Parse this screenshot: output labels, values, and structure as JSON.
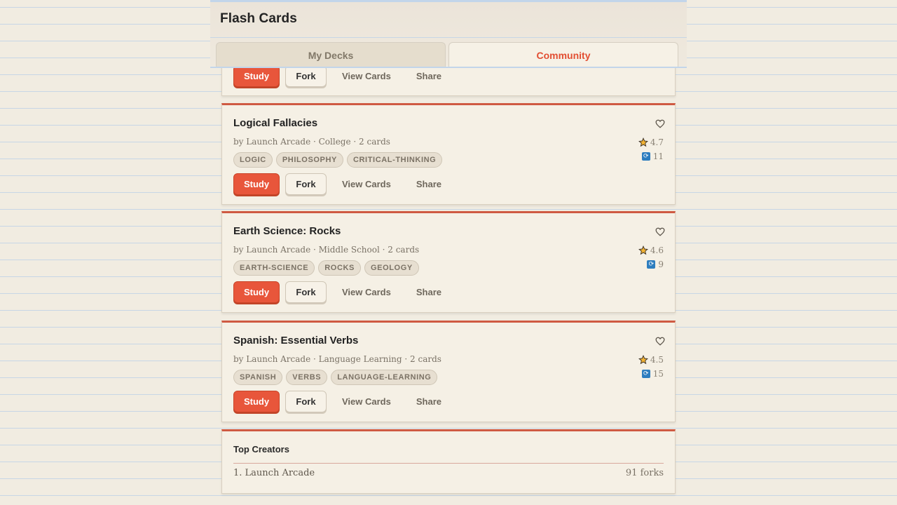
{
  "app": {
    "title": "Flash Cards"
  },
  "tabs": [
    {
      "label": "My Decks",
      "active": false
    },
    {
      "label": "Community",
      "active": true
    }
  ],
  "actions": {
    "study": "Study",
    "fork": "Fork",
    "view_cards": "View Cards",
    "share": "Share"
  },
  "decks": [
    {
      "title": "Logical Fallacies",
      "meta": "by Launch Arcade · College · 2 cards",
      "rating": "4.7",
      "forks": "11",
      "tags": [
        "LOGIC",
        "PHILOSOPHY",
        "CRITICAL-THINKING"
      ]
    },
    {
      "title": "Earth Science: Rocks",
      "meta": "by Launch Arcade · Middle School · 2 cards",
      "rating": "4.6",
      "forks": "9",
      "tags": [
        "EARTH-SCIENCE",
        "ROCKS",
        "GEOLOGY"
      ]
    },
    {
      "title": "Spanish: Essential Verbs",
      "meta": "by Launch Arcade · Language Learning · 2 cards",
      "rating": "4.5",
      "forks": "15",
      "tags": [
        "SPANISH",
        "VERBS",
        "LANGUAGE-LEARNING"
      ]
    }
  ],
  "top_creators": {
    "title": "Top Creators",
    "items": [
      {
        "rank_name": "1. Launch Arcade",
        "forks": "91 forks"
      }
    ]
  },
  "colors": {
    "accent": "#e8563b",
    "active_tab": "#e24e32",
    "fork_badge": "#2d7dbf",
    "star": "#f2b233"
  }
}
